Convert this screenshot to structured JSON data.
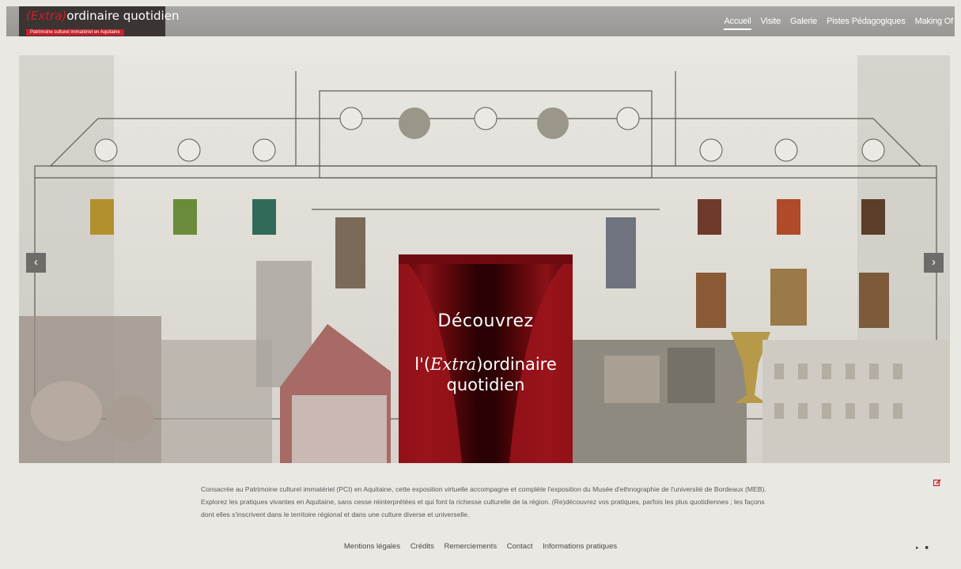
{
  "header": {
    "logo_title_accent": "(Extra)",
    "logo_title_rest": "ordinaire quotidien",
    "logo_subtitle": "Patrimoine culturel immatériel en Aquitaine",
    "nav": [
      {
        "label": "Accueil",
        "active": true
      },
      {
        "label": "Visite",
        "active": false
      },
      {
        "label": "Galerie",
        "active": false
      },
      {
        "label": "Pistes Pédagogiques",
        "active": false
      },
      {
        "label": "Making Of",
        "active": false
      }
    ]
  },
  "carousel": {
    "prev_icon": "chevron-left-icon",
    "next_icon": "chevron-right-icon",
    "prev_glyph": "‹",
    "next_glyph": "›",
    "line1": "Découvrez",
    "line2_prefix": "l'(",
    "line2_accent": "Extra",
    "line2_suffix": ")ordinaire",
    "line3": "quotidien"
  },
  "main": {
    "description": "Consacrée au Patrimoine culturel immatériel (PCI) en Aquitaine, cette exposition virtuelle accompagne et complète l'exposition du Musée d'ethnographie de l'université de Bordeaux (MEB). Explorez les pratiques vivantes en Aquitaine, sans cesse réinterprétées et qui font la richesse culturelle de la région. (Re)découvrez vos pratiques, parfois les plus quotidiennes ; les façons dont elles s'inscrivent dans le territoire régional et dans une culture diverse et universelle.",
    "edit_icon": "edit-icon"
  },
  "footer": {
    "links": [
      "Mentions légales",
      "Crédits",
      "Remerciements",
      "Contact",
      "Informations pratiques"
    ],
    "pager": "▸ ■"
  },
  "colors": {
    "accent": "#c8202a",
    "background": "#e9e8e3",
    "header_bar": "#a09f9b",
    "curtain": "#7a0d12"
  }
}
